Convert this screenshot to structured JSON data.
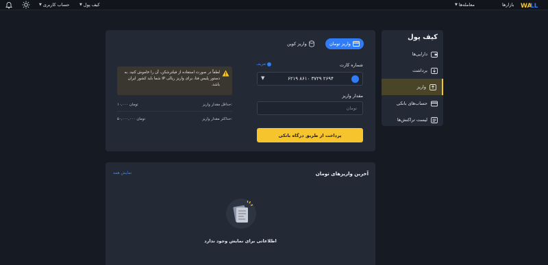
{
  "topbar": {
    "logo": "WALLEX",
    "markets": "بازارها",
    "trades": "معامله‌ها",
    "wallet": "کیف پول",
    "account": "حساب کاربری"
  },
  "sidebar": {
    "title": "کیف پول",
    "items": [
      {
        "label": "دارایی‌ها",
        "icon": "wallet-icon"
      },
      {
        "label": "برداشت",
        "icon": "withdraw-icon"
      },
      {
        "label": "واریز",
        "icon": "deposit-icon"
      },
      {
        "label": "حساب‌های بانکی",
        "icon": "bank-card-icon"
      },
      {
        "label": "لیست تراکنش‌ها",
        "icon": "list-icon"
      }
    ],
    "active_index": 2
  },
  "deposit": {
    "tab_toman": "واریز تومان",
    "tab_coin": "واریز کوین",
    "card_label": "شماره کارت",
    "card_link": "تعریف",
    "card_number": "۶۲۱۹ ۸۶۱۰ ۳۷۲۹ ۲۶۹۴",
    "amount_label": "مقدار واریز",
    "amount_placeholder": "تومان",
    "pay_button": "پرداخت از طریق درگاه بانکی",
    "warning": "لطفاً در صورت استفاده از فیلترشکن، آن را خاموش کنید. به دستور پلیس فتا، برای واریز ریالی IP شما باید کشور ایران باشد.",
    "min_label": "حداقل مقدار واریز:",
    "min_value": "۱۰,۰۰۰ تومان",
    "max_label": "حداکثر مقدار واریز:",
    "max_value": "۵۰,۰۰۰,۰۰۰ تومان"
  },
  "recent": {
    "title": "آخرین واریزهای تومان",
    "show_all": "نمایش همه",
    "empty": "اطلاعاتی برای نمایش وجود ندارد"
  },
  "colors": {
    "accent_blue": "#2f7cf6",
    "accent_yellow": "#f6c42c",
    "background": "#161a22",
    "panel": "#232935"
  }
}
